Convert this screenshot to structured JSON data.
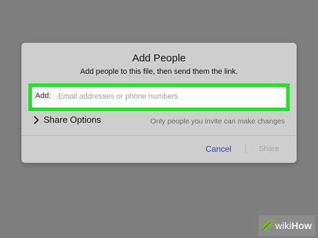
{
  "dialog": {
    "title": "Add People",
    "subtitle": "Add people to this file, then send them the link.",
    "add_field": {
      "label": "Add:",
      "value": "",
      "placeholder": "Email addresses or phone numbers",
      "highlight_color": "#19e81c"
    },
    "share_options": {
      "icon": "chevron-right-icon",
      "label": "Share Options",
      "note": "Only people you invite can make changes"
    },
    "buttons": {
      "cancel": "Cancel",
      "share": "Share"
    }
  },
  "colors": {
    "backdrop": "#7f7f7f",
    "dialog_background": "#cecece",
    "link_blue": "#2a4f9c",
    "disabled_gray": "#a6a6a6"
  },
  "watermark": {
    "brand_wiki": "wiki",
    "brand_how": "How",
    "icon": "leaf-logo-icon"
  }
}
